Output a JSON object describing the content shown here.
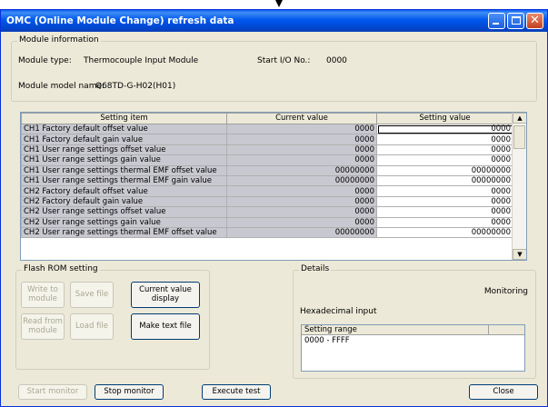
{
  "window": {
    "title": "OMC (Online Module Change) refresh data"
  },
  "module_info": {
    "group_title": "Module information",
    "type_label": "Module type:",
    "type_value": "Thermocouple Input Module",
    "start_io_label": "Start I/O No.:",
    "start_io_value": "0000",
    "model_label": "Module model name:",
    "model_value": "Q68TD-G-H02(H01)"
  },
  "grid": {
    "headers": [
      "Setting item",
      "Current value",
      "Setting value"
    ],
    "rows": [
      {
        "item": "CH1 Factory default offset value",
        "current": "0000",
        "setting": "0000"
      },
      {
        "item": "CH1 Factory default gain value",
        "current": "0000",
        "setting": "0000"
      },
      {
        "item": "CH1 User range settings offset value",
        "current": "0000",
        "setting": "0000"
      },
      {
        "item": "CH1 User range settings gain value",
        "current": "0000",
        "setting": "0000"
      },
      {
        "item": "CH1 User range settings thermal EMF offset value",
        "current": "00000000",
        "setting": "00000000"
      },
      {
        "item": "CH1 User range settings thermal EMF gain value",
        "current": "00000000",
        "setting": "00000000"
      },
      {
        "item": "CH2 Factory default offset value",
        "current": "0000",
        "setting": "0000"
      },
      {
        "item": "CH2 Factory default gain value",
        "current": "0000",
        "setting": "0000"
      },
      {
        "item": "CH2 User range settings offset value",
        "current": "0000",
        "setting": "0000"
      },
      {
        "item": "CH2 User range settings gain value",
        "current": "0000",
        "setting": "0000"
      },
      {
        "item": "CH2 User range settings thermal EMF offset value",
        "current": "00000000",
        "setting": "00000000"
      }
    ]
  },
  "flash_rom": {
    "group_title": "Flash ROM setting",
    "write_to_module": "Write to module",
    "save_file": "Save file",
    "read_from_module": "Read from module",
    "load_file": "Load file",
    "current_value_display": "Current value display",
    "make_text_file": "Make text file"
  },
  "details": {
    "group_title": "Details",
    "status": "Monitoring",
    "input_mode": "Hexadecimal input",
    "range_header": "Setting range",
    "range_value": "0000 - FFFF"
  },
  "footer": {
    "start_monitor": "Start monitor",
    "stop_monitor": "Stop monitor",
    "execute_test": "Execute test",
    "close": "Close"
  }
}
